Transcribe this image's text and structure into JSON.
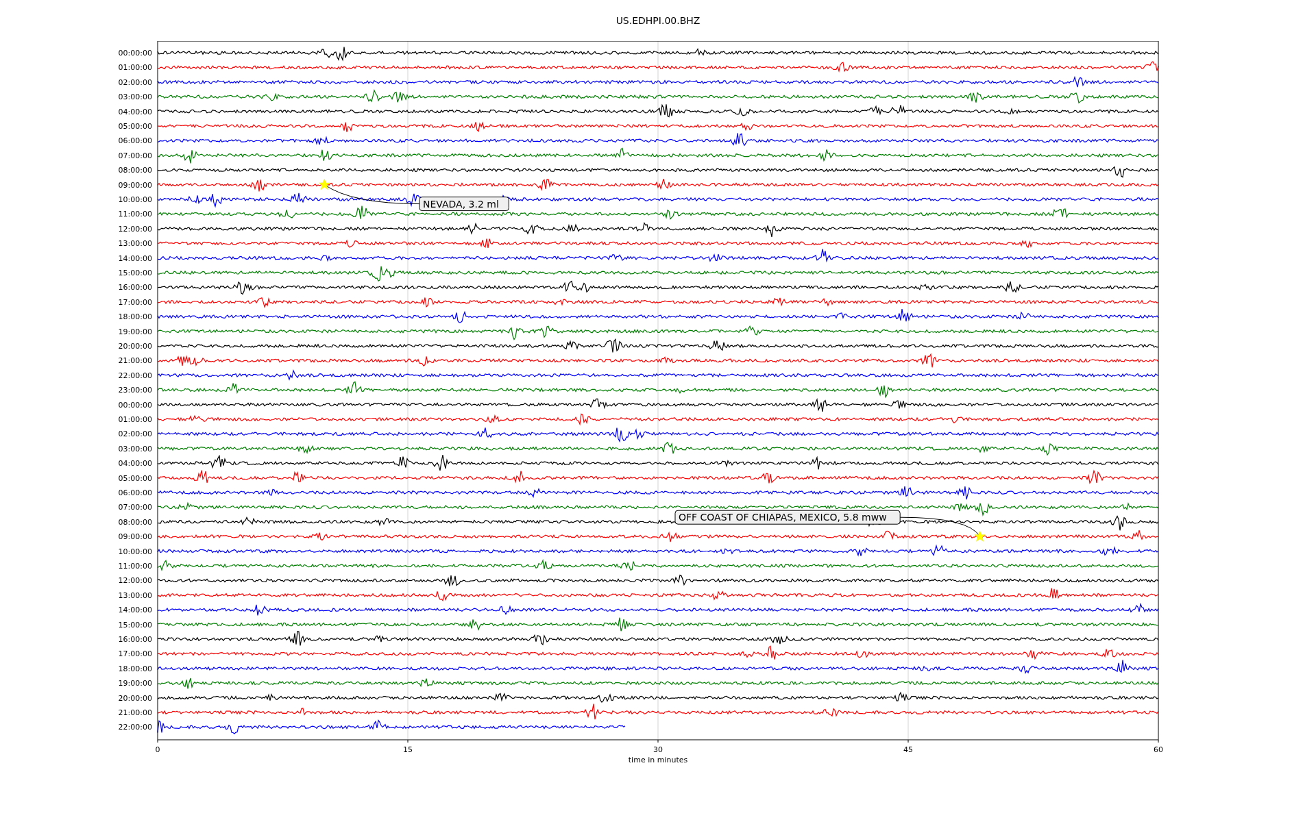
{
  "title": "US.EDHPI.00.BHZ",
  "rows": [
    {
      "label": "00:00:00",
      "color": "#000000",
      "partial": false
    },
    {
      "label": "01:00:00",
      "color": "#ff0000",
      "partial": false
    },
    {
      "label": "02:00:00",
      "color": "#0000ff",
      "partial": false
    },
    {
      "label": "03:00:00",
      "color": "#008000",
      "partial": false
    },
    {
      "label": "04:00:00",
      "color": "#000000",
      "partial": false
    },
    {
      "label": "05:00:00",
      "color": "#ff0000",
      "partial": false
    },
    {
      "label": "06:00:00",
      "color": "#0000ff",
      "partial": false
    },
    {
      "label": "07:00:00",
      "color": "#008000",
      "partial": false
    },
    {
      "label": "08:00:00",
      "color": "#000000",
      "partial": false
    },
    {
      "label": "09:00:00",
      "color": "#ff0000",
      "partial": false,
      "event": {
        "text": "NEVADA, 3.2 ml"
      }
    },
    {
      "label": "10:00:00",
      "color": "#0000ff",
      "partial": false
    },
    {
      "label": "11:00:00",
      "color": "#008000",
      "partial": false
    },
    {
      "label": "12:00:00",
      "color": "#000000",
      "partial": false
    },
    {
      "label": "13:00:00",
      "color": "#ff0000",
      "partial": false
    },
    {
      "label": "14:00:00",
      "color": "#0000ff",
      "partial": false
    },
    {
      "label": "15:00:00",
      "color": "#008000",
      "partial": false
    },
    {
      "label": "16:00:00",
      "color": "#000000",
      "partial": false
    },
    {
      "label": "17:00:00",
      "color": "#ff0000",
      "partial": false
    },
    {
      "label": "18:00:00",
      "color": "#0000ff",
      "partial": false
    },
    {
      "label": "19:00:00",
      "color": "#008000",
      "partial": false
    },
    {
      "label": "20:00:00",
      "color": "#000000",
      "partial": false
    },
    {
      "label": "21:00:00",
      "color": "#ff0000",
      "partial": false
    },
    {
      "label": "22:00:00",
      "color": "#0000ff",
      "partial": false
    },
    {
      "label": "23:00:00",
      "color": "#008000",
      "partial": false
    },
    {
      "label": "00:00:00",
      "color": "#000000",
      "partial": false
    },
    {
      "label": "01:00:00",
      "color": "#ff0000",
      "partial": false
    },
    {
      "label": "02:00:00",
      "color": "#0000ff",
      "partial": false
    },
    {
      "label": "03:00:00",
      "color": "#008000",
      "partial": false
    },
    {
      "label": "04:00:00",
      "color": "#000000",
      "partial": false
    },
    {
      "label": "05:00:00",
      "color": "#ff0000",
      "partial": false
    },
    {
      "label": "06:00:00",
      "color": "#0000ff",
      "partial": false
    },
    {
      "label": "07:00:00",
      "color": "#008000",
      "partial": false
    },
    {
      "label": "08:00:00",
      "color": "#000000",
      "partial": false
    },
    {
      "label": "09:00:00",
      "color": "#ff0000",
      "partial": false,
      "event": {
        "text": "OFF COAST OF CHIAPAS, MEXICO, 5.8 mww"
      }
    },
    {
      "label": "10:00:00",
      "color": "#0000ff",
      "partial": false
    },
    {
      "label": "11:00:00",
      "color": "#008000",
      "partial": false
    },
    {
      "label": "12:00:00",
      "color": "#000000",
      "partial": false
    },
    {
      "label": "13:00:00",
      "color": "#ff0000",
      "partial": false
    },
    {
      "label": "14:00:00",
      "color": "#0000ff",
      "partial": false
    },
    {
      "label": "15:00:00",
      "color": "#008000",
      "partial": false
    },
    {
      "label": "16:00:00",
      "color": "#000000",
      "partial": false
    },
    {
      "label": "17:00:00",
      "color": "#ff0000",
      "partial": false
    },
    {
      "label": "18:00:00",
      "color": "#0000ff",
      "partial": false
    },
    {
      "label": "19:00:00",
      "color": "#008000",
      "partial": false
    },
    {
      "label": "20:00:00",
      "color": "#000000",
      "partial": false
    },
    {
      "label": "21:00:00",
      "color": "#ff0000",
      "partial": false
    },
    {
      "label": "22:00:00",
      "color": "#0000ff",
      "partial": true
    }
  ],
  "x_axis": {
    "ticks": [
      "0",
      "15",
      "30",
      "45",
      "60"
    ],
    "label": "time in minutes"
  }
}
